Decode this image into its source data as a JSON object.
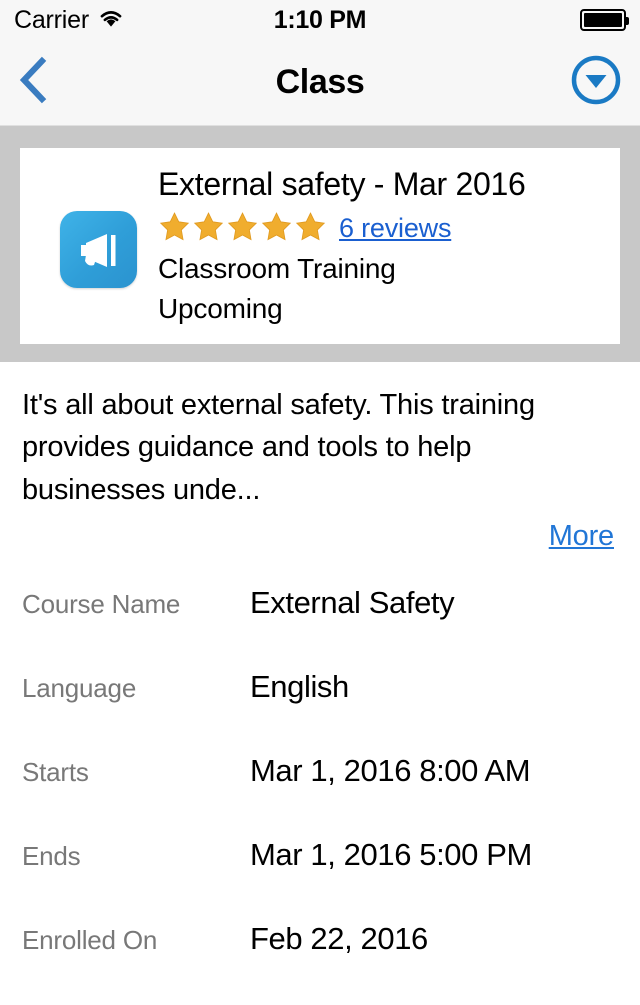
{
  "status_bar": {
    "carrier": "Carrier",
    "wifi_icon": "wifi-icon",
    "time": "1:10 PM",
    "battery_icon": "battery-full-icon"
  },
  "nav_bar": {
    "back_icon": "chevron-left-icon",
    "title": "Class",
    "action_icon": "circle-chevron-down-icon"
  },
  "course_card": {
    "icon": "megaphone-icon",
    "title": "External safety - Mar 2016",
    "rating": 5,
    "max_rating": 5,
    "star_icon": "star-filled-icon",
    "reviews_link": "6 reviews",
    "type": "Classroom Training",
    "status": "Upcoming"
  },
  "description": {
    "text": "It's all about external safety. This training provides guidance and tools to help businesses unde...",
    "more_label": "More"
  },
  "details": [
    {
      "label": "Course Name",
      "value": "External Safety"
    },
    {
      "label": "Language",
      "value": "English"
    },
    {
      "label": "Starts",
      "value": "Mar 1, 2016 8:00 AM"
    },
    {
      "label": "Ends",
      "value": "Mar 1, 2016 5:00 PM"
    },
    {
      "label": "Enrolled On",
      "value": "Feb 22, 2016"
    }
  ],
  "colors": {
    "accent_blue": "#2176d6",
    "link_blue": "#1a5fd0",
    "star_gold": "#f0ad2e",
    "band_gray": "#c8c8c8",
    "label_gray": "#787878",
    "bar_gray": "#f7f7f7",
    "icon_blue": "#2f9ed8"
  }
}
